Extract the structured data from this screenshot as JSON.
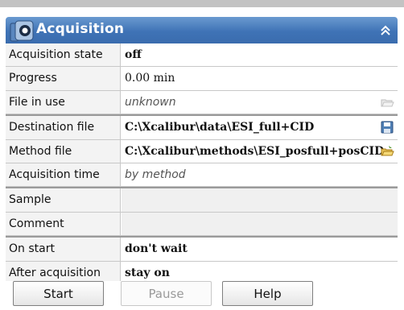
{
  "panel": {
    "title": "Acquisition",
    "collapse_icon": "double-chevron-up-icon"
  },
  "rows": [
    {
      "label": "Acquisition state",
      "value": "off"
    },
    {
      "label": "Progress",
      "value": "0.00 min"
    },
    {
      "label": "File in use",
      "value": "unknown"
    },
    {
      "label": "Destination file",
      "value": "C:\\Xcalibur\\data\\ESI_full+CID"
    },
    {
      "label": "Method file",
      "value": "C:\\Xcalibur\\methods\\ESI_posfull+posCID"
    },
    {
      "label": "Acquisition time",
      "value": "by method"
    },
    {
      "label": "Sample",
      "value": ""
    },
    {
      "label": "Comment",
      "value": ""
    },
    {
      "label": "On start",
      "value": "don't wait"
    },
    {
      "label": "After acquisition",
      "value": "stay on"
    }
  ],
  "buttons": {
    "start": "Start",
    "pause": "Pause",
    "help": "Help"
  },
  "colors": {
    "header": "#3f73b6",
    "label_bg": "#f3f3f3"
  }
}
